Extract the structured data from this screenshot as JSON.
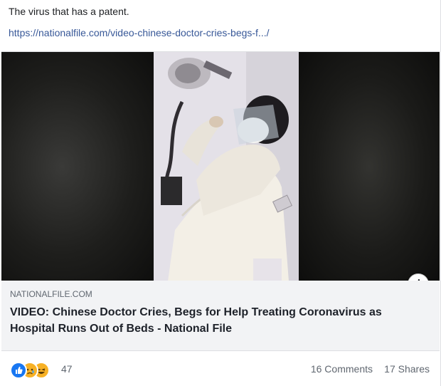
{
  "post": {
    "text": "The virus that has a patent.",
    "link_url": "https://nationalfile.com/video-chinese-doctor-cries-begs-f.../"
  },
  "link_preview": {
    "domain": "NATIONALFILE.COM",
    "headline": "VIDEO: Chinese Doctor Cries, Begs for Help Treating Coronavirus as Hospital Runs Out of Beds - National File",
    "info_icon": "info-icon"
  },
  "footer": {
    "reactions": [
      "like-icon",
      "sad-icon",
      "haha-icon"
    ],
    "reaction_count": "47",
    "comments": "16 Comments",
    "shares": "17 Shares"
  },
  "colors": {
    "link": "#385898",
    "like": "#1877f2",
    "emoji": "#f7b125",
    "preview_bg": "#f2f3f5"
  }
}
